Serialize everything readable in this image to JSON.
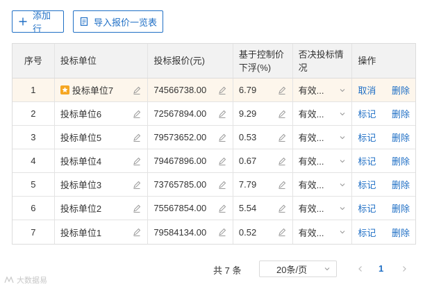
{
  "toolbar": {
    "add_row_label": "添加行",
    "import_label": "导入报价一览表"
  },
  "table": {
    "headers": [
      "序号",
      "投标单位",
      "投标报价(元)",
      "基于控制价下浮(%)",
      "否决投标情况",
      "操作"
    ],
    "rows": [
      {
        "no": "1",
        "bidder": "投标单位7",
        "price": "74566738.00",
        "rate": "6.79",
        "status": "有效...",
        "op1": "取消",
        "op2": "删除",
        "starred": true
      },
      {
        "no": "2",
        "bidder": "投标单位6",
        "price": "72567894.00",
        "rate": "9.29",
        "status": "有效...",
        "op1": "标记",
        "op2": "删除"
      },
      {
        "no": "3",
        "bidder": "投标单位5",
        "price": "79573652.00",
        "rate": "0.53",
        "status": "有效...",
        "op1": "标记",
        "op2": "删除"
      },
      {
        "no": "4",
        "bidder": "投标单位4",
        "price": "79467896.00",
        "rate": "0.67",
        "status": "有效...",
        "op1": "标记",
        "op2": "删除"
      },
      {
        "no": "5",
        "bidder": "投标单位3",
        "price": "73765785.00",
        "rate": "7.79",
        "status": "有效...",
        "op1": "标记",
        "op2": "删除"
      },
      {
        "no": "6",
        "bidder": "投标单位2",
        "price": "75567854.00",
        "rate": "5.54",
        "status": "有效...",
        "op1": "标记",
        "op2": "删除"
      },
      {
        "no": "7",
        "bidder": "投标单位1",
        "price": "79584134.00",
        "rate": "0.52",
        "status": "有效...",
        "op1": "标记",
        "op2": "删除"
      }
    ]
  },
  "pagination": {
    "total": "共 7 条",
    "page_size": "20条/页",
    "current_page": "1"
  },
  "watermark": "大数据易",
  "colors": {
    "accent": "#1f6fc5",
    "active_row": "#fdf6ec",
    "header_bg": "#f2f2f2",
    "star": "#f5a623"
  }
}
